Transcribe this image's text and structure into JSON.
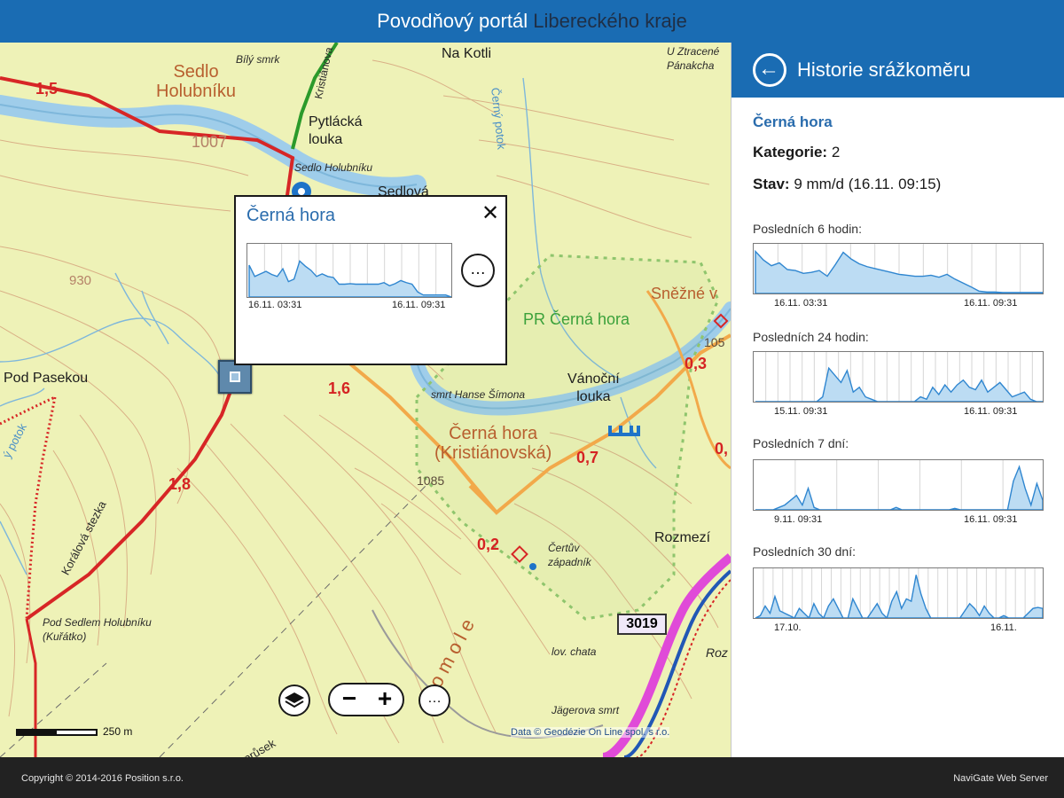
{
  "header": {
    "title_main": "Povodňový portál",
    "title_region": "Libereckého kraje"
  },
  "map": {
    "place_labels": {
      "sedlo": "Sedlo\nHolubníku",
      "cerna_hora": "Černá hora\n(Kristiánovská)",
      "pylacka": "Pytlácká\nlouka",
      "na_kotli": "Na Kotli",
      "pod_pasekou": "Pod Pasekou",
      "vanocni": "Vánoční\nlouka",
      "rozmezi": "Rozmezí",
      "snezne": "Sněžné v",
      "pr_cerna": "PR Černá hora",
      "sedlova": "Sedlová",
      "sedlo_small": "Sedlo Holubníku",
      "bily_smrk": "Bílý smrk",
      "pod_sedlem": "Pod Sedlem Holubníku\n(Kuřátko)",
      "smrk_hanse": "smrt Hanse Šímona",
      "certuv": "Čertův\nzápadník",
      "jagerova": "Jägerova smrt",
      "homole": "Homole",
      "koralova": "Korálová stezka",
      "ztracene": "U Ztracené\nPánakcha",
      "cerny_potok": "Černý potok",
      "kristianova": "Kristiánova",
      "cerny_potok2": "Černý potok",
      "prusek": "průsek",
      "ly_potok": "ý potok",
      "roz": "Roz",
      "lov_chata": "lov. chata"
    },
    "numbers": {
      "n15": "1,5",
      "n16": "1,6",
      "n18": "1,8",
      "n07": "0,7",
      "n03": "0,3",
      "n02": "0,2",
      "n0x": "0,",
      "e1007": "1007",
      "e1085": "1085",
      "e930": "930",
      "e105": "105"
    },
    "road_number": "3019",
    "scale_label": "250 m",
    "attribution": "Data © Geodézie On Line spol. s r.o.",
    "layers_icon": "layers-icon",
    "zoom_out": "−",
    "zoom_in": "+",
    "more": "…",
    "colors": {
      "map_bg": "#eef2b7",
      "water": "#9fcdea",
      "trail_red": "#d72626",
      "trail_orange": "#f2a94a",
      "trail_green": "#2b9a2b",
      "reserve": "#8fc56d",
      "road_pink": "#e04ad8",
      "trail_blue": "#2157b5",
      "contour": "#d4a07a"
    }
  },
  "popup": {
    "title": "Černá hora",
    "close": "✕",
    "more": "…",
    "tick_start": "16.11. 03:31",
    "tick_end": "16.11. 09:31"
  },
  "sidebar": {
    "back_icon": "arrow-left-icon",
    "title": "Historie srážkoměru",
    "station_name": "Černá hora",
    "category_label": "Kategorie:",
    "category_value": "2",
    "status_label": "Stav:",
    "status_value": "9 mm/d (16.11. 09:15)",
    "charts": [
      {
        "title": "Posledních 6 hodin:",
        "tick_start": "16.11. 03:31",
        "tick_end": "16.11. 09:31"
      },
      {
        "title": "Posledních 24 hodin:",
        "tick_start": "15.11. 09:31",
        "tick_end": "16.11. 09:31"
      },
      {
        "title": "Posledních 7 dní:",
        "tick_start": "9.11. 09:31",
        "tick_end": "16.11. 09:31"
      },
      {
        "title": "Posledních 30 dní:",
        "tick_start": "17.10.",
        "tick_end": "16.11."
      }
    ]
  },
  "chart_data": [
    {
      "type": "area",
      "id": "popup",
      "ylim": [
        0,
        100
      ],
      "grid": true,
      "x": [
        0,
        1,
        2,
        3,
        4,
        5,
        6,
        7,
        8,
        9,
        10,
        11,
        12,
        13,
        14,
        15,
        16,
        17,
        18,
        19,
        20,
        21,
        22,
        23,
        24,
        25,
        26,
        27,
        28,
        29,
        30,
        31,
        32,
        33,
        34,
        35,
        36
      ],
      "values": [
        62,
        40,
        45,
        50,
        44,
        40,
        55,
        30,
        35,
        70,
        60,
        52,
        40,
        45,
        40,
        38,
        25,
        25,
        26,
        25,
        25,
        25,
        25,
        25,
        28,
        22,
        26,
        32,
        28,
        25,
        10,
        4,
        4,
        4,
        4,
        4,
        0
      ]
    },
    {
      "type": "area",
      "id": "h6",
      "ylim": [
        0,
        100
      ],
      "grid": true,
      "x": [
        0,
        1,
        2,
        3,
        4,
        5,
        6,
        7,
        8,
        9,
        10,
        11,
        12,
        13,
        14,
        15,
        16,
        17,
        18,
        19,
        20,
        21,
        22,
        23,
        24,
        25,
        26,
        27,
        28,
        29,
        30,
        31,
        32,
        33,
        34,
        35,
        36
      ],
      "values": [
        88,
        70,
        58,
        64,
        50,
        48,
        42,
        44,
        48,
        36,
        60,
        86,
        72,
        62,
        56,
        52,
        48,
        44,
        40,
        38,
        36,
        36,
        38,
        34,
        40,
        30,
        22,
        14,
        5,
        3,
        3,
        2,
        2,
        2,
        2,
        2,
        2
      ]
    },
    {
      "type": "area",
      "id": "h24",
      "ylim": [
        0,
        100
      ],
      "grid": true,
      "x": [
        0,
        1,
        2,
        3,
        4,
        5,
        6,
        7,
        8,
        9,
        10,
        11,
        12,
        13,
        14,
        15,
        16,
        17,
        18,
        19,
        20,
        21,
        22,
        23,
        24,
        25,
        26,
        27,
        28,
        29,
        30,
        31,
        32,
        33,
        34,
        35,
        36,
        37,
        38,
        39,
        40,
        41,
        42,
        43,
        44,
        45,
        46,
        47
      ],
      "values": [
        0,
        0,
        0,
        0,
        0,
        0,
        0,
        0,
        0,
        0,
        0,
        10,
        70,
        55,
        40,
        65,
        20,
        30,
        10,
        5,
        0,
        0,
        0,
        0,
        0,
        0,
        0,
        10,
        5,
        30,
        15,
        35,
        20,
        35,
        45,
        30,
        25,
        45,
        20,
        30,
        40,
        25,
        10,
        15,
        20,
        5,
        0,
        0
      ]
    },
    {
      "type": "area",
      "id": "d7",
      "ylim": [
        0,
        100
      ],
      "grid": true,
      "x": [
        0,
        1,
        2,
        3,
        4,
        5,
        6,
        7,
        8,
        9,
        10,
        11,
        12,
        13,
        14,
        15,
        16,
        17,
        18,
        19,
        20,
        21,
        22,
        23,
        24,
        25,
        26,
        27,
        28,
        29,
        30,
        31,
        32,
        33,
        34,
        35,
        36,
        37,
        38,
        39,
        40,
        41,
        42,
        43,
        44,
        45,
        46,
        47,
        48,
        49
      ],
      "values": [
        0,
        0,
        0,
        0,
        5,
        10,
        20,
        30,
        10,
        45,
        5,
        0,
        0,
        0,
        0,
        0,
        0,
        0,
        0,
        0,
        0,
        0,
        0,
        0,
        5,
        0,
        0,
        0,
        0,
        0,
        0,
        0,
        0,
        0,
        3,
        0,
        0,
        0,
        0,
        0,
        0,
        0,
        0,
        0,
        60,
        90,
        45,
        10,
        55,
        20
      ]
    },
    {
      "type": "area",
      "id": "d30",
      "ylim": [
        0,
        100
      ],
      "grid": true,
      "x": [
        0,
        1,
        2,
        3,
        4,
        5,
        6,
        7,
        8,
        9,
        10,
        11,
        12,
        13,
        14,
        15,
        16,
        17,
        18,
        19,
        20,
        21,
        22,
        23,
        24,
        25,
        26,
        27,
        28,
        29,
        30,
        31,
        32,
        33,
        34,
        35,
        36,
        37,
        38,
        39,
        40,
        41,
        42,
        43,
        44,
        45,
        46,
        47,
        48,
        49,
        50,
        51,
        52,
        53,
        54,
        55,
        56,
        57,
        58,
        59
      ],
      "values": [
        0,
        5,
        25,
        10,
        45,
        15,
        10,
        5,
        0,
        20,
        10,
        0,
        30,
        10,
        0,
        25,
        40,
        20,
        0,
        0,
        40,
        20,
        0,
        0,
        15,
        30,
        10,
        0,
        35,
        55,
        20,
        40,
        35,
        90,
        50,
        20,
        0,
        0,
        0,
        0,
        0,
        0,
        0,
        15,
        30,
        20,
        5,
        25,
        10,
        0,
        0,
        5,
        0,
        0,
        0,
        0,
        10,
        20,
        22,
        20
      ]
    }
  ]
}
